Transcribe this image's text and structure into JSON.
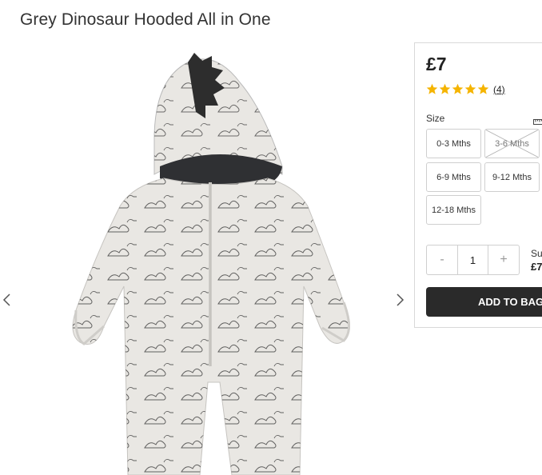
{
  "product": {
    "title": "Grey Dinosaur Hooded All in One",
    "price": "£7",
    "rating": {
      "stars": 5,
      "review_count": "(4)"
    }
  },
  "gallery": {
    "prev_icon": "chevron-left-icon",
    "next_icon": "chevron-right-icon"
  },
  "size": {
    "label": "Size",
    "options": [
      {
        "label": "0-3 Mths",
        "available": true
      },
      {
        "label": "3-6 Mths",
        "available": false
      },
      {
        "label": "6-9 Mths",
        "available": true
      },
      {
        "label": "9-12 Mths",
        "available": true
      },
      {
        "label": "12-18 Mths",
        "available": true
      }
    ]
  },
  "quantity": {
    "decrement": "-",
    "value": "1",
    "increment": "+"
  },
  "subtotal": {
    "label": "Su",
    "value": "£7"
  },
  "cart": {
    "add_label": "ADD TO BAG"
  },
  "colors": {
    "star": "#f5b400",
    "button": "#2a2a2a"
  }
}
